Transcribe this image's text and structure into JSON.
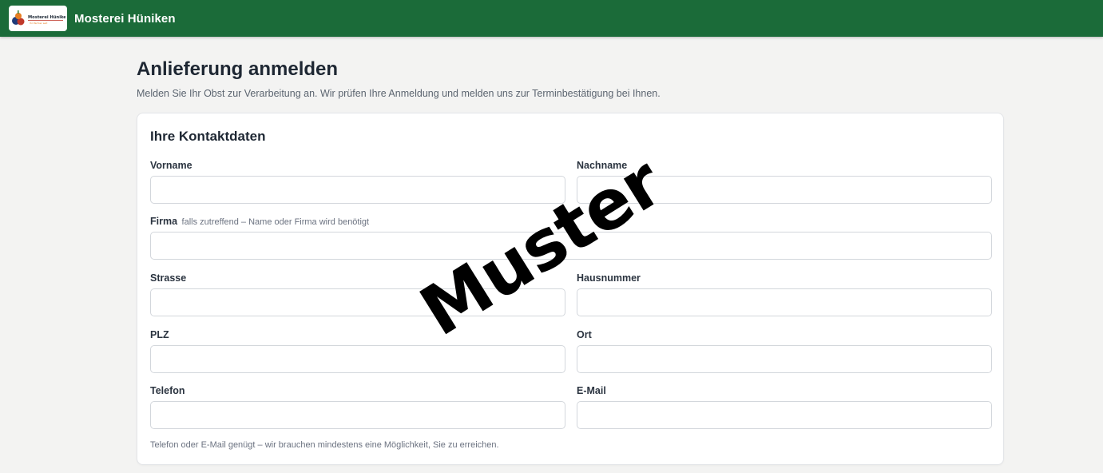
{
  "header": {
    "brand": "Mosterei Hüniken",
    "logo_text": "Mosterei Hüniken",
    "logo_sub": "Ihr Partner seit"
  },
  "page": {
    "title": "Anlieferung anmelden",
    "subtitle": "Melden Sie Ihr Obst zur Verarbeitung an. Wir prüfen Ihre Anmeldung und melden uns zur Terminbestätigung bei Ihnen."
  },
  "form": {
    "section_title": "Ihre Kontaktdaten",
    "fields": {
      "vorname": {
        "label": "Vorname",
        "value": ""
      },
      "nachname": {
        "label": "Nachname",
        "value": ""
      },
      "firma": {
        "label": "Firma",
        "hint": "falls zutreffend – Name oder Firma wird benötigt",
        "value": ""
      },
      "strasse": {
        "label": "Strasse",
        "value": ""
      },
      "hausnummer": {
        "label": "Hausnummer",
        "value": ""
      },
      "plz": {
        "label": "PLZ",
        "value": ""
      },
      "ort": {
        "label": "Ort",
        "value": ""
      },
      "telefon": {
        "label": "Telefon",
        "value": ""
      },
      "email": {
        "label": "E-Mail",
        "value": ""
      }
    },
    "contact_hint": "Telefon oder E-Mail genügt – wir brauchen mindestens eine Möglichkeit, Sie zu erreichen."
  },
  "watermark": "Muster",
  "colors": {
    "header_bg": "#1b6b39",
    "page_bg": "#f3f3f2",
    "card_bg": "#ffffff"
  }
}
